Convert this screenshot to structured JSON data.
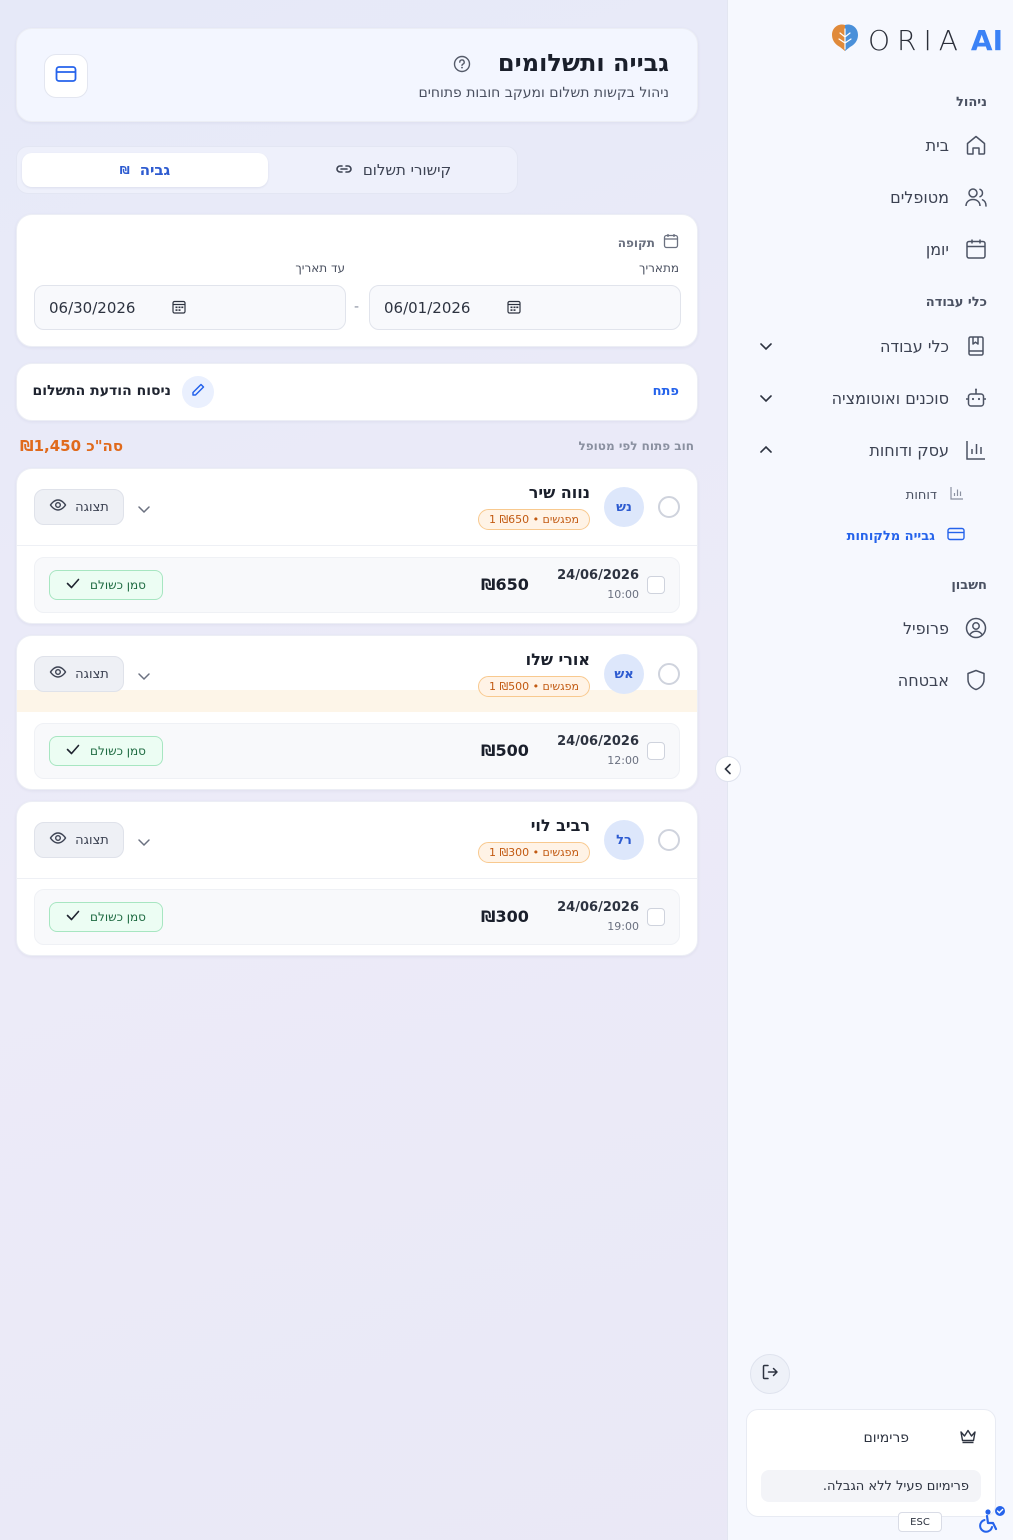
{
  "app": {
    "brand": "ORIA",
    "brand_ai": "AI"
  },
  "header": {
    "title": "גבייה ותשלומים",
    "subtitle": "ניהול בקשות תשלום ומעקב חובות פתוחים"
  },
  "tabs": {
    "billing": "גביה",
    "billing_symbol": "₪",
    "payment_links": "קישורי תשלום"
  },
  "period": {
    "label": "תקופה",
    "from_label": "מתאריך",
    "to_label": "עד תאריך",
    "from_value": "06/01/2026",
    "to_value": "06/30/2026",
    "separator": "-"
  },
  "template": {
    "title": "ניסוח הודעת התשלום",
    "open_label": "פתח"
  },
  "debts": {
    "label": "חוב פתוח לפי מטופל",
    "total": "סה\"כ ₪1,450"
  },
  "patients": [
    {
      "initials": "נש",
      "name": "נווה שיר",
      "badge": "מפגשים • ₪650 1",
      "view_label": "תצוגה",
      "session": {
        "date": "24/06/2026",
        "time": "10:00",
        "amount": "₪650",
        "mark_paid": "סמן כשולם"
      }
    },
    {
      "initials": "אש",
      "name": "אורי שלו",
      "badge": "מפגשים • ₪500 1",
      "view_label": "תצוגה",
      "session": {
        "date": "24/06/2026",
        "time": "12:00",
        "amount": "₪500",
        "mark_paid": "סמן כשולם"
      }
    },
    {
      "initials": "רל",
      "name": "רביב לוי",
      "badge": "מפגשים • ₪300 1",
      "view_label": "תצוגה",
      "session": {
        "date": "24/06/2026",
        "time": "19:00",
        "amount": "₪300",
        "mark_paid": "סמן כשולם"
      }
    }
  ],
  "sidebar": {
    "sections": {
      "management": "ניהול",
      "work_tools": "כלי עבודה",
      "account": "חשבון"
    },
    "items": {
      "home": "בית",
      "patients": "מטופלים",
      "calendar": "יומן",
      "tools": "כלי עבודה",
      "agents": "סוכנים ואוטומציה",
      "business": "עסק ודוחות",
      "reports": "דוחות",
      "client_billing": "גבייה מלקוחות",
      "profile": "פרופיל",
      "security": "אבטחה"
    },
    "premium": {
      "title": "פרימיום",
      "text": "פרימיום פעיל ללא הגבלה."
    },
    "esc": "ESC"
  },
  "colors": {
    "accent": "#2563eb",
    "warning": "#e06a1c",
    "success": "#1f6b42"
  }
}
